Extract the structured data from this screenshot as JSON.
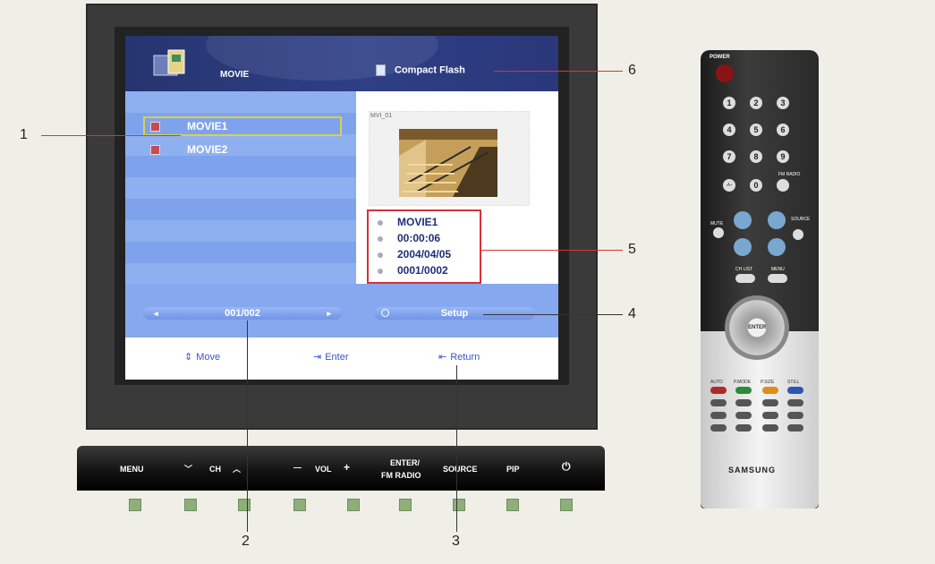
{
  "screen": {
    "title": "MOVIE",
    "storage_label": "Compact Flash",
    "list_items": [
      "MOVIE1",
      "MOVIE2"
    ],
    "preview_tag": "MVI_01",
    "info": [
      "MOVIE1",
      "00:00:06",
      "2004/04/05",
      "0001/0002"
    ],
    "pager": "001/002",
    "pager_left": "◂",
    "pager_right": "▸",
    "setup": "Setup",
    "guide": [
      {
        "icon": "move-icon",
        "glyph": "⇕",
        "label": "Move"
      },
      {
        "icon": "enter-icon",
        "glyph": "⇥",
        "label": "Enter"
      },
      {
        "icon": "return-icon",
        "glyph": "⇤",
        "label": "Return"
      }
    ]
  },
  "tv_buttons": {
    "menu": "MENU",
    "ch_down": "﹀",
    "ch": "CH",
    "ch_up": "︿",
    "vol_down": "—",
    "vol": "VOL",
    "vol_up": "+",
    "enter_line1": "ENTER/",
    "enter_line2": "FM RADIO",
    "source": "SOURCE",
    "pip": "PIP",
    "power": "⏻"
  },
  "callouts": [
    "1",
    "2",
    "3",
    "4",
    "5",
    "6"
  ],
  "remote": {
    "power": "POWER",
    "digits": [
      "1",
      "2",
      "3",
      "4",
      "5",
      "6",
      "7",
      "8",
      "9",
      "-/--",
      "0"
    ],
    "fm_radio": "FM RADIO",
    "mute": "MUTE",
    "ch_list": "CH LIST",
    "menu": "MENU",
    "source": "SOURCE",
    "enter": "ENTER",
    "color_row": [
      "AUTO",
      "P.MODE",
      "P.SIZE",
      "STILL"
    ],
    "brand": "SAMSUNG"
  },
  "colors": {
    "header": "#26346f",
    "band": "#86a8ef",
    "selection": "#d8d24a",
    "info_border": "#d9303a",
    "accent_text": "#1d2f7a"
  }
}
